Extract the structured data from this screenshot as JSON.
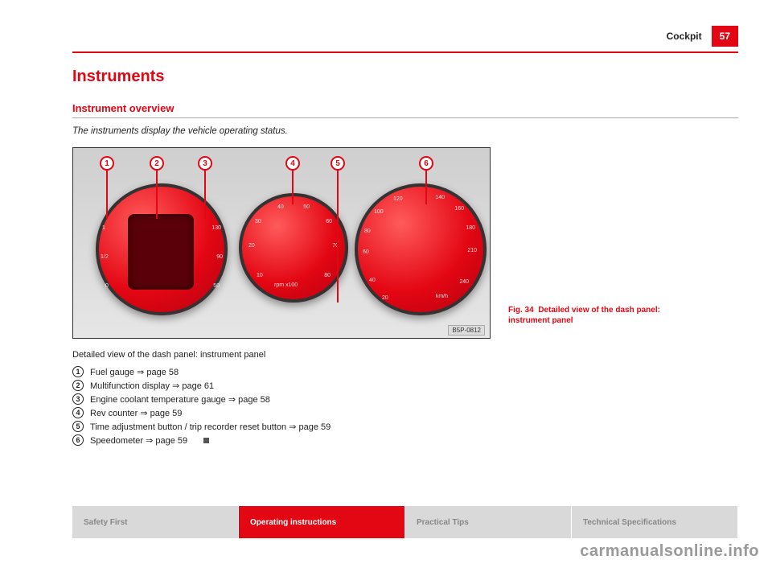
{
  "header": {
    "chapter": "Cockpit",
    "page_number": "57"
  },
  "section_title": "Instruments",
  "subsection_title": "Instrument overview",
  "lead_text": "The instruments display the vehicle operating status.",
  "figure": {
    "callouts": [
      "1",
      "2",
      "3",
      "4",
      "5",
      "6"
    ],
    "ref_code": "B5P-0812",
    "ticks_mid": [
      "10",
      "20",
      "30",
      "40",
      "50",
      "60",
      "70",
      "80"
    ],
    "ticks_right": [
      "20",
      "40",
      "60",
      "80",
      "100",
      "120",
      "140",
      "160",
      "180",
      "210",
      "240"
    ],
    "ticks_left_fuel": [
      "0",
      "1/2",
      "1"
    ],
    "ticks_left_temp": [
      "50",
      "90",
      "130"
    ],
    "mid_label": "rpm x100",
    "right_label": "km/h"
  },
  "figure_caption": {
    "label": "Fig. 34",
    "text": "Detailed view of the dash panel: instrument panel"
  },
  "detailed_desc": "Detailed view of the dash panel: instrument panel",
  "legend": [
    {
      "n": "1",
      "text": "Fuel gauge ⇒ page 58"
    },
    {
      "n": "2",
      "text": "Multifunction display ⇒ page 61"
    },
    {
      "n": "3",
      "text": "Engine coolant temperature gauge ⇒ page 58"
    },
    {
      "n": "4",
      "text": "Rev counter ⇒ page 59"
    },
    {
      "n": "5",
      "text": "Time adjustment button / trip recorder reset button ⇒ page 59"
    },
    {
      "n": "6",
      "text": "Speedometer ⇒ page 59"
    }
  ],
  "footer_tabs": {
    "t1": "Safety First",
    "t2": "Operating instructions",
    "t3": "Practical Tips",
    "t4": "Technical Specifications"
  },
  "watermark": "carmanualsonline.info"
}
